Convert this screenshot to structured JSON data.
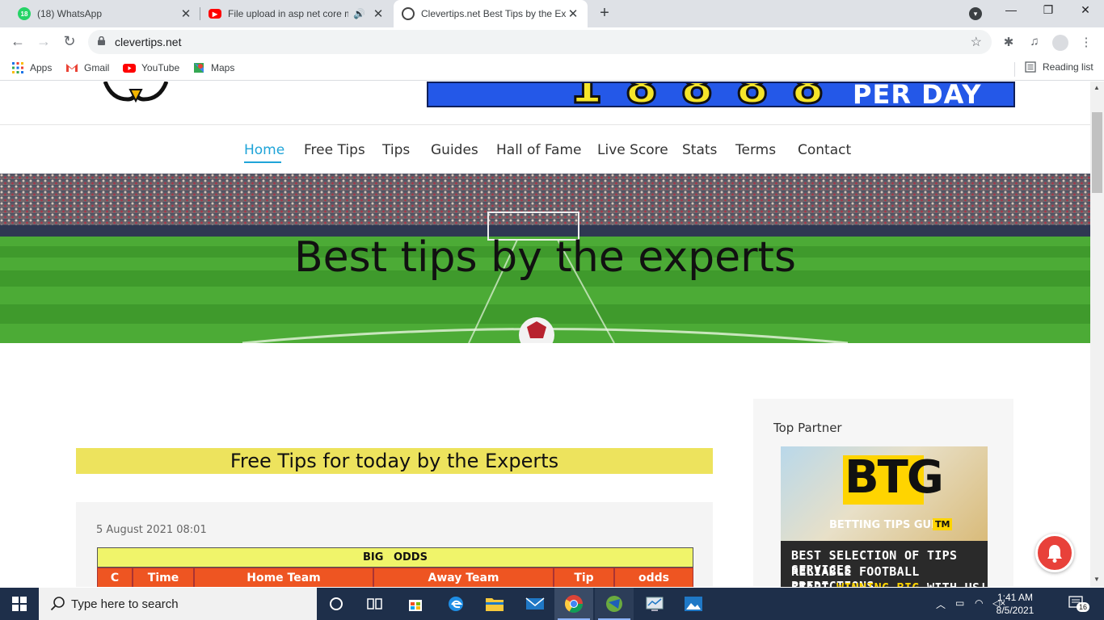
{
  "browser": {
    "tabs": [
      {
        "title": "(18) WhatsApp",
        "badge": "18",
        "color": "#25d366"
      },
      {
        "title": "File upload in asp net core m",
        "color": "#ff0000"
      },
      {
        "title": "Clevertips.net Best Tips by the Ex",
        "color": "#444444"
      }
    ],
    "new_tab_label": "+",
    "window_controls": {
      "minimize": "—",
      "restore": "❐",
      "close": "✕"
    },
    "url": "clevertips.net",
    "bookmarks": [
      "Apps",
      "Gmail",
      "YouTube",
      "Maps"
    ],
    "reading_list": "Reading list"
  },
  "site": {
    "nav": [
      "Home",
      "Free Tips",
      "Tips",
      "Guides",
      "Hall of Fame",
      "Live Score",
      "Stats",
      "Terms",
      "Contact"
    ],
    "banner_perday": "PER DAY",
    "hero_title": "Best tips by the experts",
    "free_tips_heading": "Free Tips for today by the Experts",
    "tips_date": "5 August 2021 08:01",
    "table_caption": "BIG ODDS",
    "table_headers": [
      "C",
      "Time",
      "Home Team",
      "Away Team",
      "Tip",
      "odds"
    ],
    "sidebar_title": "Top Partner",
    "ad": {
      "logo": "BTG",
      "brand": "BETTING TIPS GURU",
      "tm": "TM",
      "line1": "BEST SELECTION OF TIPS SERVICES",
      "line2": "RELIABLE FOOTBALL PREDICTIONS",
      "line3_a": "START ",
      "line3_b": "WINNING BIG",
      "line3_c": " WITH US!"
    },
    "accent_color": "#1fa4d8"
  },
  "taskbar": {
    "search_placeholder": "Type here to search",
    "time": "1:41 AM",
    "date": "8/5/2021",
    "notification_count": "16"
  }
}
